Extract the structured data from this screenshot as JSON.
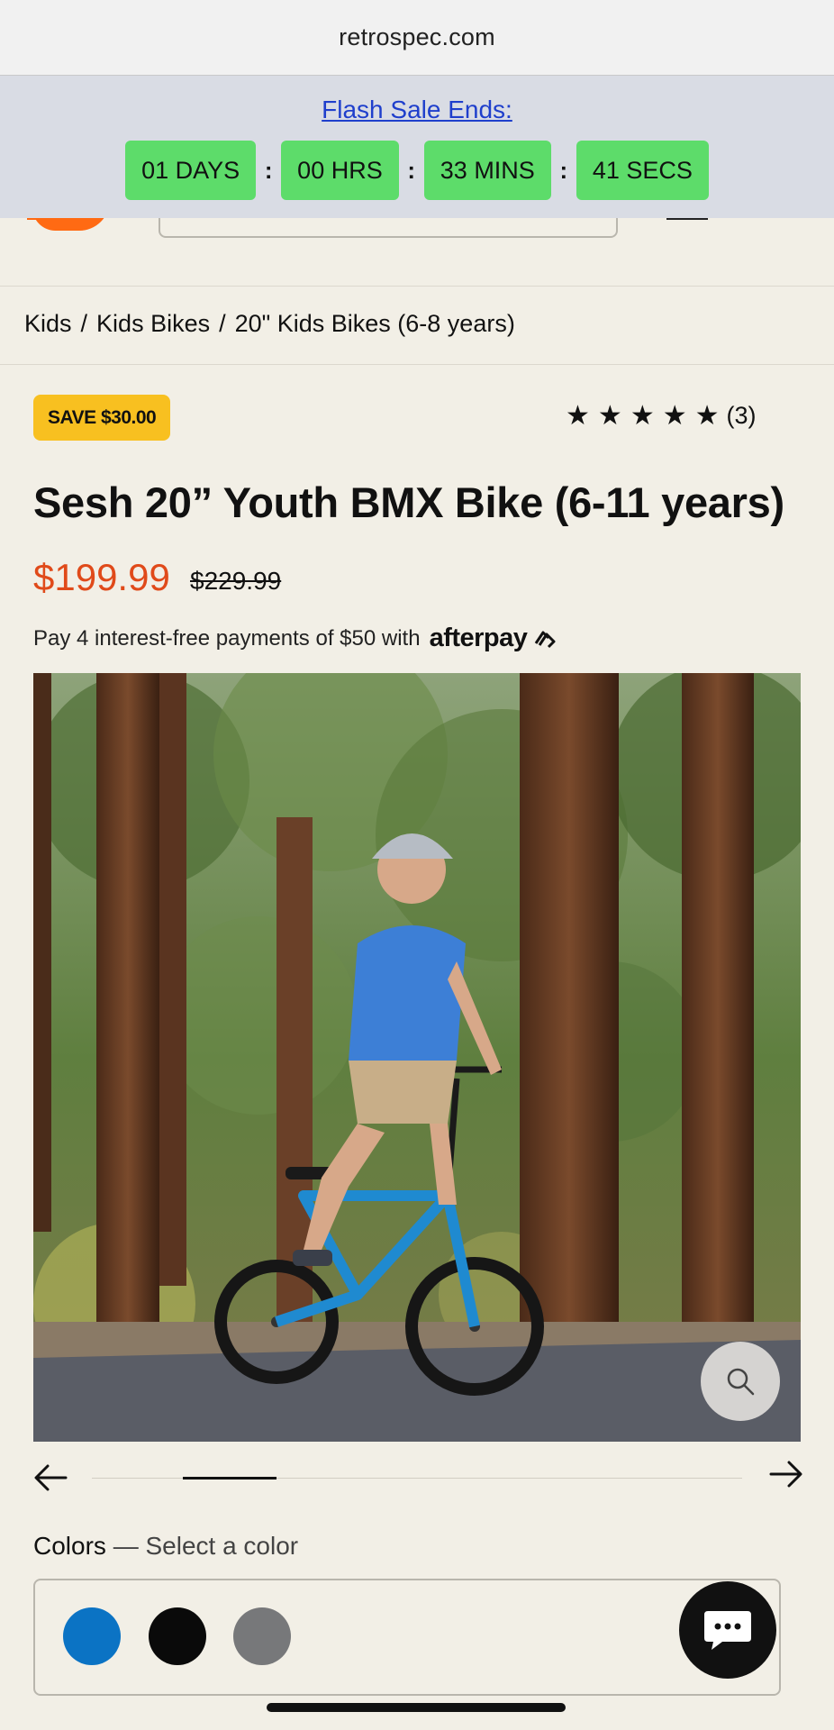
{
  "browser": {
    "url": "retrospec.com"
  },
  "flash_sale": {
    "title": "Flash Sale Ends:",
    "countdown": [
      {
        "value": "01",
        "unit": "DAYS"
      },
      {
        "value": "00",
        "unit": "HRS"
      },
      {
        "value": "33",
        "unit": "MINS"
      },
      {
        "value": "41",
        "unit": "SECS"
      }
    ],
    "separator": ":",
    "colors": {
      "box": "#5ddc6a",
      "banner": "#d9dce4"
    }
  },
  "breadcrumb": [
    "Kids",
    "Kids Bikes",
    "20\" Kids Bikes (6-8 years)"
  ],
  "breadcrumb_separator": "/",
  "product": {
    "badge": "SAVE $30.00",
    "rating_stars": 5,
    "review_count": "(3)",
    "title": "Sesh 20” Youth BMX Bike (6-11 years)",
    "price": "$199.99",
    "original_price": "$229.99",
    "price_color": "#e04a1a",
    "payment_text": "Pay 4 interest-free payments of $50 with",
    "payment_brand": "afterpay"
  },
  "gallery": {
    "zoom_icon": "search-icon",
    "prev_icon": "arrow-left-icon",
    "next_icon": "arrow-right-icon"
  },
  "colors": {
    "label": "Colors",
    "dash": "—",
    "prompt": "Select a color",
    "options": [
      {
        "name": "blue",
        "hex": "#0b73c4"
      },
      {
        "name": "black",
        "hex": "#0a0a0a"
      },
      {
        "name": "gray",
        "hex": "#77787a"
      }
    ]
  },
  "chat": {
    "icon": "chat-bubble-icon"
  }
}
